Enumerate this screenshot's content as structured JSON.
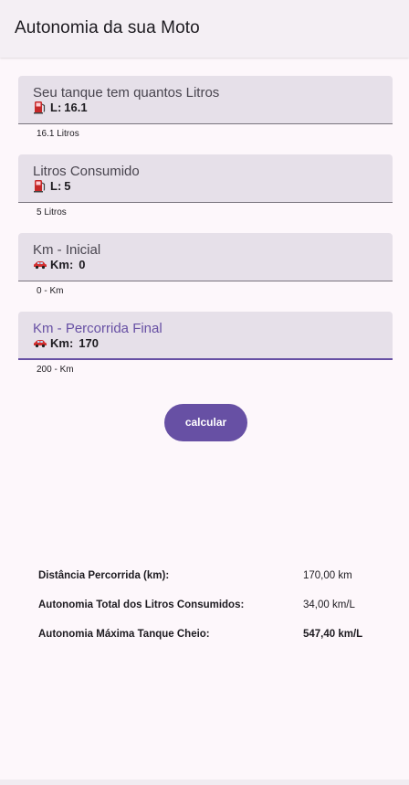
{
  "app_bar": {
    "title": "Autonomia da sua Moto"
  },
  "fields": [
    {
      "label": "Seu tanque tem quantos Litros",
      "icon": "fuel-pump-icon",
      "prefix": "L:",
      "value": "16.1",
      "helper": "16.1 Litros",
      "focused": false
    },
    {
      "label": "Litros Consumido",
      "icon": "fuel-pump-icon",
      "prefix": "L:",
      "value": "5",
      "helper": "5 Litros",
      "focused": false
    },
    {
      "label": "Km - Inicial",
      "icon": "car-icon",
      "prefix": "Km:",
      "value": "0",
      "helper": "0 - Km",
      "focused": false
    },
    {
      "label": "Km - Percorrida Final",
      "icon": "car-icon",
      "prefix": "Km:",
      "value": "170",
      "helper": "200 - Km",
      "focused": true
    }
  ],
  "button": {
    "label": "calcular"
  },
  "results": [
    {
      "label": "Distância Percorrida (km):",
      "value": "170,00 km"
    },
    {
      "label": "Autonomia Total dos Litros Consumidos:",
      "value": "34,00 km/L"
    },
    {
      "label": "Autonomia Máxima Tanque Cheio:",
      "value": "547,40 km/L"
    }
  ],
  "colors": {
    "primary": "#6750a4",
    "field_bg": "#e6e0e9",
    "background": "#fdf7fb"
  }
}
